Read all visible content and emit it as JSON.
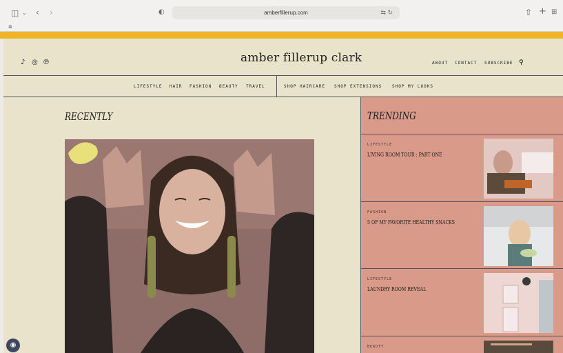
{
  "browser": {
    "url": "amberfillerup.com",
    "icons": [
      "sidebar-icon",
      "back-icon",
      "forward-icon",
      "shield-icon",
      "translate-icon",
      "reload-icon",
      "share-icon",
      "new-tab-icon",
      "tab-overview-icon",
      "reader-icon"
    ]
  },
  "header": {
    "logo": "amber fillerup clark",
    "social": [
      "tiktok-icon",
      "instagram-icon",
      "pinterest-icon"
    ],
    "nav": [
      "ABOUT",
      "CONTACT",
      "SUBSCRIBE"
    ]
  },
  "categories": {
    "left": [
      "LIFESTYLE",
      "HAIR",
      "FASHION",
      "BEAUTY",
      "TRAVEL"
    ],
    "right": [
      "SHOP HAIRCARE",
      "SHOP EXTENSIONS",
      "SHOP MY LOOKS"
    ]
  },
  "main": {
    "recently_heading": "RECENTLY"
  },
  "trending": {
    "heading": "TRENDING",
    "items": [
      {
        "category": "LIFESTYLE",
        "title": "LIVING ROOM TOUR : PART ONE"
      },
      {
        "category": "FASHION",
        "title": "5 OF MY FAVORITE HEALTHY SNACKS"
      },
      {
        "category": "LIFESTYLE",
        "title": "LAUNDRY ROOM REVEAL"
      },
      {
        "category": "BEAUTY",
        "title": ""
      }
    ]
  },
  "colors": {
    "accent": "#f0b429",
    "cream": "#e9e3cc",
    "trending_bg": "#d99a8a"
  }
}
